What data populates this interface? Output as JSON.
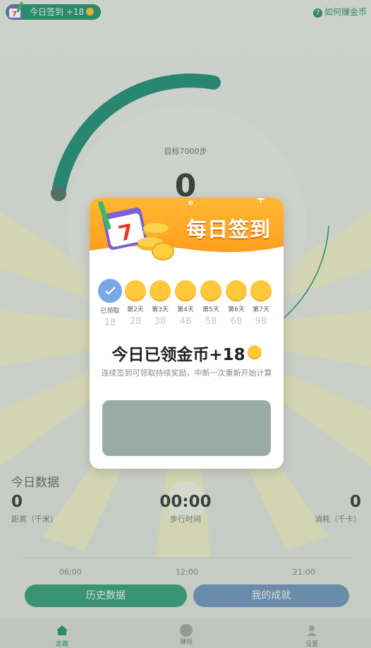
{
  "header": {
    "checkin_label": "今日签到 +18",
    "help_label": "如何赚金币"
  },
  "gauge": {
    "goal_label": "目标7000步",
    "steps": "0",
    "progress_fraction": 0.0
  },
  "modal": {
    "title": "每日签到",
    "days": [
      {
        "label": "已领取",
        "value": "18",
        "checked": true
      },
      {
        "label": "第2天",
        "value": "28",
        "checked": false
      },
      {
        "label": "第3天",
        "value": "38",
        "checked": false
      },
      {
        "label": "第4天",
        "value": "48",
        "checked": false
      },
      {
        "label": "第5天",
        "value": "58",
        "checked": false
      },
      {
        "label": "第6天",
        "value": "68",
        "checked": false
      },
      {
        "label": "第7天",
        "value": "98",
        "checked": false
      }
    ],
    "claimed_text": "今日已领金币+18",
    "note": "连续签到可领取持续奖励，中断一次重新开始计算"
  },
  "today": {
    "title": "今日数据",
    "distance": {
      "value": "0",
      "label": "距离（千米）"
    },
    "time": {
      "value": "00:00",
      "label": "步行时间"
    },
    "calories": {
      "value": "0",
      "label": "消耗（千卡）"
    }
  },
  "timeline": {
    "ticks": [
      "06:00",
      "12:00",
      "21:00"
    ]
  },
  "buttons": {
    "history": "历史数据",
    "achievements": "我的成就"
  },
  "tabs": [
    {
      "label": "走路",
      "icon": "home-icon"
    },
    {
      "label": "赚钱",
      "icon": "coin-icon"
    },
    {
      "label": "设置",
      "icon": "user-icon"
    }
  ],
  "colors": {
    "brand_green": "#1b8f6b",
    "history_button": "#2e9a76",
    "achievement_button": "#6b90b8",
    "modal_header": "#ffa624",
    "coin": "#ffc83a"
  }
}
